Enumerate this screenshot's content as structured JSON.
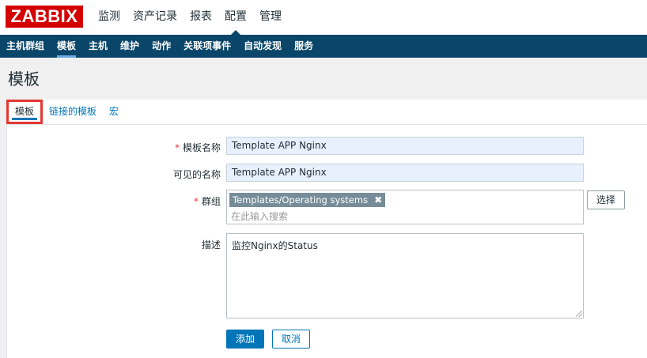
{
  "header": {
    "logo": "ZABBIX",
    "menu": [
      {
        "label": "监测"
      },
      {
        "label": "资产记录"
      },
      {
        "label": "报表"
      },
      {
        "label": "配置"
      },
      {
        "label": "管理"
      }
    ]
  },
  "subnav": [
    {
      "label": "主机群组"
    },
    {
      "label": "模板"
    },
    {
      "label": "主机"
    },
    {
      "label": "维护"
    },
    {
      "label": "动作"
    },
    {
      "label": "关联项事件"
    },
    {
      "label": "自动发现"
    },
    {
      "label": "服务"
    }
  ],
  "page_title": "模板",
  "tabs": [
    {
      "label": "模板"
    },
    {
      "label": "链接的模板"
    },
    {
      "label": "宏"
    }
  ],
  "form": {
    "template_name": {
      "label": "模板名称",
      "value": "Template APP Nginx",
      "required": "*"
    },
    "visible_name": {
      "label": "可见的名称",
      "value": "Template APP Nginx"
    },
    "groups": {
      "label": "群组",
      "required": "*",
      "tag": "Templates/Operating systems",
      "tag_remove": "✖",
      "placeholder": "在此输入搜索",
      "select_label": "选择"
    },
    "description": {
      "label": "描述",
      "value": "监控Nginx的Status"
    },
    "add_label": "添加",
    "cancel_label": "取消"
  },
  "colors": {
    "brand": "#d40000",
    "subnav_bg": "#0a466a",
    "primary": "#0275b8",
    "highlight_box": "#e33734"
  }
}
